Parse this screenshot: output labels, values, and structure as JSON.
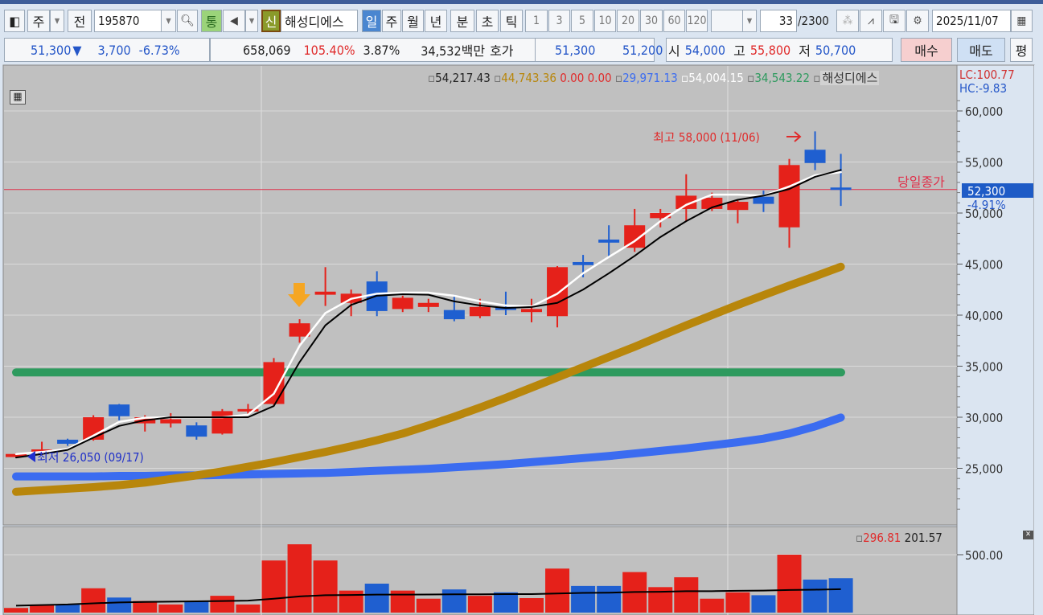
{
  "toolbar": {
    "market": "주",
    "prev": "전",
    "code": "195870",
    "tong": "통",
    "sin": "신",
    "name": "해성디에스",
    "periods": [
      "일",
      "주",
      "월",
      "년",
      "분",
      "초",
      "틱"
    ],
    "active_period": "일",
    "intervals": [
      "1",
      "3",
      "5",
      "10",
      "20",
      "30",
      "60",
      "120"
    ],
    "count": "33",
    "total": "/2300",
    "date": "2025/11/07"
  },
  "quote": {
    "price": "51,300",
    "arrow": "▼",
    "change": "3,700",
    "change_pct": "-6.73%",
    "volume": "658,069",
    "vol_ratio": "105.40%",
    "turnover": "3.87%",
    "amount": "34,532백만",
    "hoga_label": "호가",
    "ask": "51,300",
    "bid": "51,200",
    "open_label": "시",
    "open": "54,000",
    "high_label": "고",
    "high": "55,800",
    "low_label": "저",
    "low": "50,700",
    "buy": "매수",
    "sell": "매도",
    "eval": "평"
  },
  "legend": {
    "ma_black": "54,217.43",
    "ma_gold": "44,743.36",
    "red_vals": "0.00 0.00",
    "ma_blue": "29,971.13",
    "ma_white": "54,004.15",
    "ma_green": "34,543.22",
    "name": "해성디에스",
    "lc": "LC:100.77",
    "hc": "HC:-9.83",
    "vol_ma1": "296.81",
    "vol_ma2": "201.57"
  },
  "colors": {
    "up": "#e5211a",
    "down": "#1f5fd0",
    "white_ma": "#ffffff",
    "black_ma": "#000000",
    "gold_ma": "#b8860b",
    "blue_ma": "#3b6cf0",
    "green_ma": "#2e9a5e",
    "close_line": "#e0304a"
  },
  "chart_data": {
    "type": "candlestick",
    "ylim": [
      20000,
      62000
    ],
    "yticks": [
      "60,000",
      "55,000",
      "50,000",
      "45,000",
      "40,000",
      "35,000",
      "30,000",
      "25,000"
    ],
    "annotations": {
      "high": "최고 58,000 (11/06)",
      "low": "최저 26,050 (09/17)",
      "close_label": "당일종가",
      "close_value": "52,300",
      "close_pct": "-4.91%",
      "close_price": 52300
    },
    "candles": [
      [
        26100,
        26500,
        26050,
        26400
      ],
      [
        26700,
        27600,
        26300,
        26850
      ],
      [
        27800,
        27900,
        27200,
        27400
      ],
      [
        27800,
        30200,
        27700,
        30000
      ],
      [
        31250,
        31300,
        29700,
        30100
      ],
      [
        29400,
        30200,
        28600,
        30000
      ],
      [
        29400,
        30400,
        29000,
        29800
      ],
      [
        29200,
        29500,
        27800,
        28100
      ],
      [
        28400,
        30800,
        28300,
        30600
      ],
      [
        30600,
        31300,
        30300,
        30800
      ],
      [
        31300,
        35800,
        31200,
        35400
      ],
      [
        37900,
        39600,
        37300,
        39200
      ],
      [
        42000,
        44700,
        40900,
        42300
      ],
      [
        41200,
        42500,
        39900,
        42100
      ],
      [
        43300,
        44300,
        39900,
        40400
      ],
      [
        40600,
        41900,
        40300,
        41700
      ],
      [
        40800,
        41600,
        40300,
        41200
      ],
      [
        40500,
        42000,
        39400,
        39600
      ],
      [
        39900,
        41600,
        39700,
        40800
      ],
      [
        40800,
        42300,
        40000,
        40500
      ],
      [
        40300,
        41600,
        39300,
        40600
      ],
      [
        39900,
        44800,
        38800,
        44700
      ],
      [
        45200,
        45900,
        43700,
        44900
      ],
      [
        47400,
        48800,
        45700,
        47100
      ],
      [
        46600,
        50400,
        46200,
        48800
      ],
      [
        49500,
        50400,
        48600,
        50000
      ],
      [
        50400,
        53800,
        49200,
        51700
      ],
      [
        50400,
        52000,
        50200,
        51500
      ],
      [
        50300,
        51300,
        49000,
        51100
      ],
      [
        51600,
        52200,
        50100,
        50900
      ],
      [
        48600,
        55300,
        46600,
        54700
      ],
      [
        56200,
        58000,
        54200,
        54900
      ],
      [
        52500,
        55800,
        50700,
        52300
      ]
    ],
    "candle_fields": [
      "open",
      "high",
      "low",
      "close"
    ],
    "ma_white": [
      26400,
      26600,
      26900,
      28200,
      29550,
      29950,
      30000,
      30000,
      30000,
      30250,
      32300,
      37000,
      40200,
      41600,
      42100,
      42200,
      42200,
      41900,
      41350,
      40950,
      40850,
      42100,
      44100,
      45700,
      47250,
      49200,
      50800,
      51800,
      51800,
      51700,
      52600,
      53700,
      54004
    ],
    "ma_black": [
      26050,
      26400,
      26800,
      28000,
      29150,
      29700,
      30000,
      30000,
      30000,
      30000,
      31100,
      35400,
      39000,
      41000,
      41900,
      42050,
      42000,
      41350,
      40950,
      40700,
      40800,
      41200,
      42500,
      44100,
      45800,
      47650,
      49200,
      50550,
      51300,
      51700,
      52350,
      53550,
      54217
    ],
    "ma_gold": [
      22700,
      22850,
      23000,
      23150,
      23350,
      23600,
      23950,
      24300,
      24700,
      25150,
      25600,
      26100,
      26600,
      27150,
      27750,
      28400,
      29200,
      30050,
      30950,
      31900,
      32900,
      33900,
      34900,
      35900,
      36900,
      37950,
      39000,
      40000,
      41000,
      41950,
      42900,
      43800,
      44743
    ],
    "ma_blue": [
      24200,
      24200,
      24200,
      24200,
      24250,
      24250,
      24300,
      24300,
      24350,
      24400,
      24450,
      24500,
      24550,
      24650,
      24750,
      24850,
      24950,
      25100,
      25250,
      25400,
      25600,
      25800,
      26000,
      26200,
      26450,
      26700,
      26950,
      27250,
      27550,
      27900,
      28400,
      29100,
      29971
    ],
    "ma_green": 34543,
    "volume_ticks": [
      "500.00"
    ],
    "volume": [
      40,
      70,
      70,
      210,
      130,
      100,
      70,
      100,
      145,
      70,
      450,
      590,
      450,
      190,
      250,
      190,
      120,
      200,
      145,
      175,
      125,
      380,
      230,
      230,
      350,
      220,
      305,
      120,
      175,
      150,
      500,
      285,
      297
    ],
    "volume_ma": [
      60,
      65,
      70,
      80,
      88,
      92,
      95,
      97,
      100,
      103,
      120,
      140,
      150,
      152,
      155,
      155,
      156,
      158,
      158,
      160,
      160,
      165,
      170,
      172,
      178,
      180,
      185,
      185,
      188,
      190,
      195,
      198,
      202
    ]
  }
}
